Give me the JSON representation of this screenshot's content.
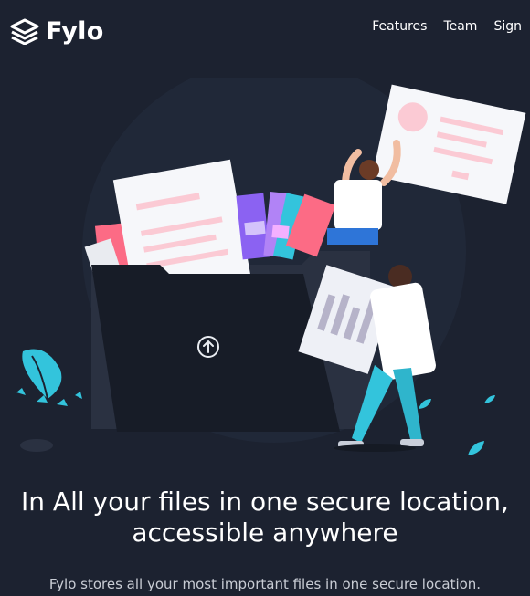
{
  "brand": {
    "name": "Fylo",
    "icon": "stacked-layers-icon"
  },
  "nav": {
    "items": [
      "Features",
      "Team",
      "Sign"
    ]
  },
  "hero": {
    "headline_line1": "In All your files in one secure location,",
    "headline_line2": "accessible anywhere",
    "subtext": "Fylo stores all your most important files in one secure location."
  },
  "colors": {
    "background": "#1c2230",
    "folder": "#1a1f2b",
    "accent_pink": "#fc6b85",
    "accent_cyan": "#33c4dc",
    "accent_purple": "#8b62f2"
  },
  "icons": {
    "upload": "upload-arrow-icon",
    "plant": "leaf-plant-icon"
  }
}
